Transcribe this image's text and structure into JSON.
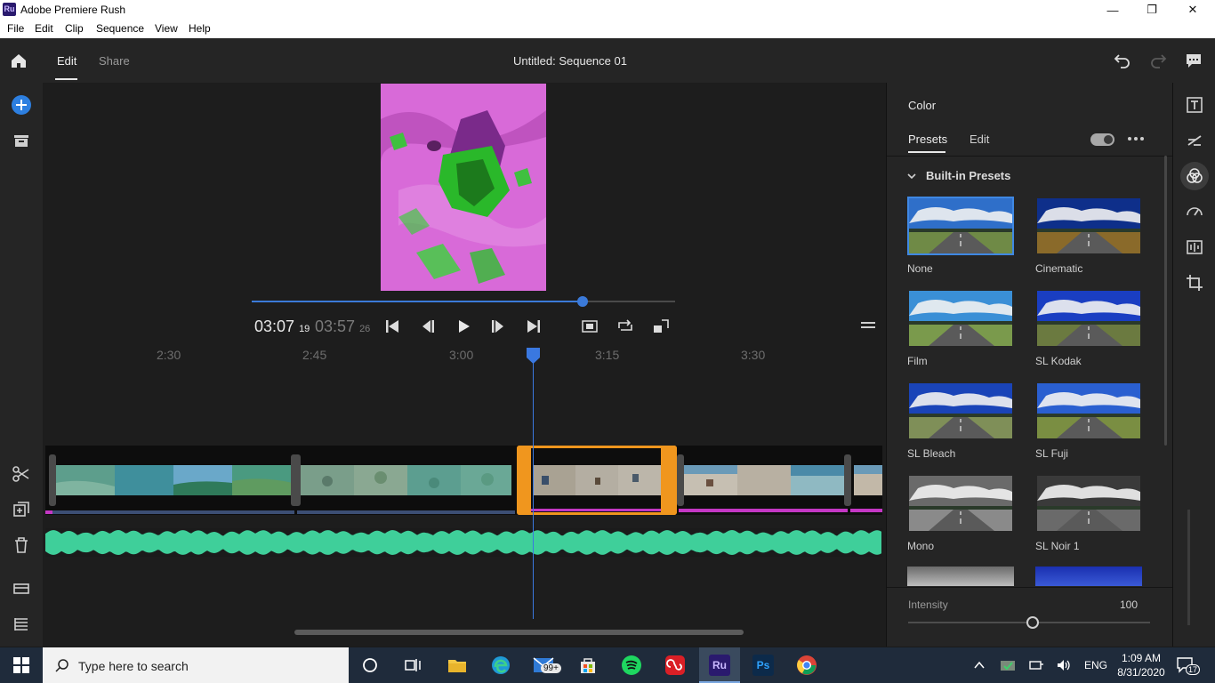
{
  "window": {
    "title": "Adobe Premiere Rush",
    "icon_text": "Ru"
  },
  "menu": [
    "File",
    "Edit",
    "Clip",
    "Sequence",
    "View",
    "Help"
  ],
  "appbar": {
    "tabs": [
      {
        "label": "Edit",
        "active": true
      },
      {
        "label": "Share",
        "active": false
      }
    ],
    "sequence_title": "Untitled: Sequence 01"
  },
  "playback": {
    "current_time": "03:07",
    "current_frames": "19",
    "total_time": "03:57",
    "total_frames": "26",
    "scrub_progress": 0.78
  },
  "timeline": {
    "ruler_labels": [
      "2:30",
      "2:45",
      "3:00",
      "3:15",
      "3:30"
    ]
  },
  "color_panel": {
    "title": "Color",
    "tabs": [
      {
        "label": "Presets",
        "active": true
      },
      {
        "label": "Edit",
        "active": false
      }
    ],
    "section_title": "Built-in Presets",
    "presets": [
      {
        "name": "None",
        "selected": true,
        "sky": "#2f6fc9",
        "ground": "#6f8a46"
      },
      {
        "name": "Cinematic",
        "selected": false,
        "sky": "#0e2f8a",
        "ground": "#8a6a2a"
      },
      {
        "name": "Film",
        "selected": false,
        "sky": "#3a8fd6",
        "ground": "#7a9a4c"
      },
      {
        "name": "SL Kodak",
        "selected": false,
        "sky": "#1a3ec2",
        "ground": "#6b7a40"
      },
      {
        "name": "SL Bleach",
        "selected": false,
        "sky": "#1a44b8",
        "ground": "#7f8f58"
      },
      {
        "name": "SL Fuji",
        "selected": false,
        "sky": "#2a5fd0",
        "ground": "#7a8e42"
      },
      {
        "name": "Mono",
        "selected": false,
        "sky": "#6a6a6a",
        "ground": "#8a8a8a"
      },
      {
        "name": "SL Noir 1",
        "selected": false,
        "sky": "#3a3a3a",
        "ground": "#6a6a6a"
      }
    ],
    "intensity_label": "Intensity",
    "intensity_value": "100",
    "intensity_fraction": 0.5
  },
  "taskbar": {
    "search_placeholder": "Type here to search",
    "mail_badge": "99+",
    "language": "ENG",
    "time": "1:09 AM",
    "date": "8/31/2020",
    "notification_count": "17"
  },
  "colors": {
    "accent_blue": "#3b7ad9",
    "selected_clip": "#f0961e",
    "audio_wave": "#3fcf9a",
    "magenta_bar": "#c437c4"
  }
}
